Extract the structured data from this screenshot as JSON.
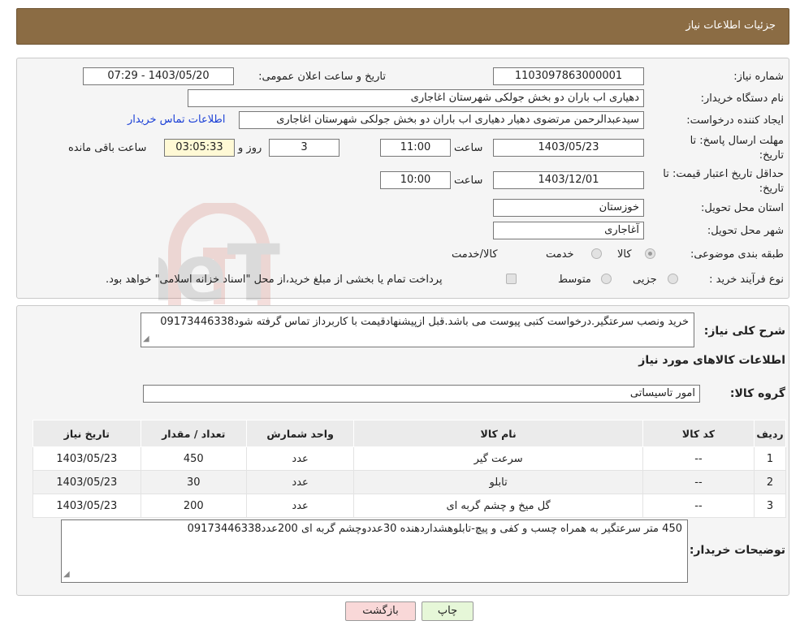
{
  "header": {
    "title": "جزئیات اطلاعات نیاز"
  },
  "form": {
    "need_number_label": "شماره نیاز:",
    "need_number": "1103097863000001",
    "announce_label": "تاریخ و ساعت اعلان عمومی:",
    "announce_value": "1403/05/20 - 07:29",
    "buyer_org_label": "نام دستگاه خریدار:",
    "buyer_org": "دهیاری اب باران دو بخش جولکی شهرستان اغاجاری",
    "creator_label": "ایجاد کننده درخواست:",
    "creator": "سیدعبدالرحمن مرتضوی دهیار دهیاری اب باران دو بخش جولکی شهرستان اغاجاری",
    "contact_link": "اطلاعات تماس خریدار",
    "deadline_label_1": "مهلت ارسال پاسخ: تا",
    "deadline_label_2": "تاریخ:",
    "deadline_date": "1403/05/23",
    "time_label": "ساعت",
    "deadline_time": "11:00",
    "days_value": "3",
    "days_label": "روز و",
    "remaining_time": "03:05:33",
    "remaining_label": "ساعت باقی مانده",
    "validity_label_1": "حداقل تاریخ اعتبار قیمت: تا",
    "validity_label_2": "تاریخ:",
    "validity_date": "1403/12/01",
    "validity_time": "10:00",
    "province_label": "استان محل تحویل:",
    "province": "خوزستان",
    "city_label": "شهر محل تحویل:",
    "city": "آغاجاری",
    "category_label": "طبقه بندی موضوعی:",
    "category_options": [
      "کالا",
      "خدمت",
      "کالا/خدمت"
    ],
    "category_selected": "کالا",
    "purchase_type_label": "نوع فرآیند خرید :",
    "purchase_options": [
      "جزیی",
      "متوسط"
    ],
    "purchase_note": "پرداخت تمام یا بخشی از مبلغ خرید،از محل \"اسناد خزانه اسلامی\" خواهد بود."
  },
  "description": {
    "label": "شرح کلی نیاز:",
    "text": "خرید ونصب سرعتگیر.درخواست کتبی پیوست می باشد.قبل ازپیشنهادقیمت  با کاربرداز تماس گرفته شود09173446338"
  },
  "goods": {
    "section_title": "اطلاعات کالاهای مورد نیاز",
    "group_label": "گروه کالا:",
    "group_value": "امور تاسیساتی",
    "columns": [
      "ردیف",
      "کد کالا",
      "نام کالا",
      "واحد شمارش",
      "تعداد / مقدار",
      "تاریخ نیاز"
    ],
    "rows": [
      [
        "1",
        "--",
        "سرعت گیر",
        "عدد",
        "450",
        "1403/05/23"
      ],
      [
        "2",
        "--",
        "تابلو",
        "عدد",
        "30",
        "1403/05/23"
      ],
      [
        "3",
        "--",
        "گل میخ و چشم گربه ای",
        "عدد",
        "200",
        "1403/05/23"
      ]
    ]
  },
  "buyer_notes": {
    "label": "توضیحات خریدار:",
    "text": "450 متر سرعتگیر به همراه چسب و کفی و پیچ-تابلوهشداردهنده 30عددوچشم گربه ای 200عدد09173446338"
  },
  "buttons": {
    "print": "چاپ",
    "back": "بازگشت"
  },
  "watermark": "AriaTender.neT",
  "colors": {
    "header_bg": "#8b6c44",
    "link": "#1a3fd6",
    "back_button": "#f9d8d8",
    "print_button": "#e6f7d8"
  }
}
